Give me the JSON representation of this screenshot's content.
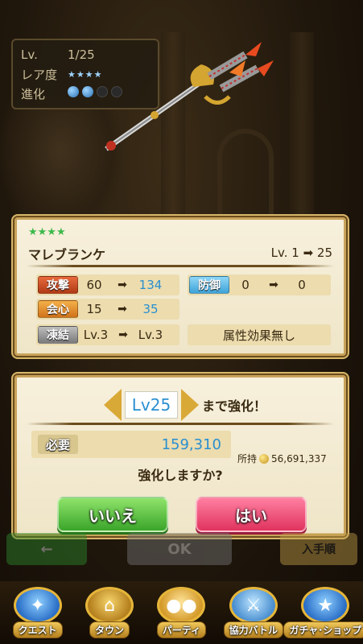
{
  "info": {
    "lv_label": "Lv.",
    "lv_value": "1/25",
    "rarity_label": "レア度",
    "rarity_stars": "★★★★",
    "evo_label": "進化",
    "evo_filled": 2,
    "evo_total": 4
  },
  "weapon": {
    "stars": "★★★★",
    "name": "マレブランケ",
    "level_text": "Lv. 1 ➡ 25",
    "stats": {
      "attack": {
        "label": "攻撃",
        "from": "60",
        "to": "134"
      },
      "defense": {
        "label": "防御",
        "from": "0",
        "to": "0"
      },
      "critical": {
        "label": "会心",
        "from": "15",
        "to": "35"
      },
      "freeze": {
        "label": "凍結",
        "from": "Lv.3",
        "to": "Lv.3"
      },
      "attribute_text": "属性効果無し"
    }
  },
  "enhance": {
    "target_lv": "Lv25",
    "until_text": "まで強化！",
    "need_label": "必要",
    "need_value": "159,310",
    "owned_label": "所持",
    "owned_value": "56,691,337",
    "question": "強化しますか?",
    "no_label": "いいえ",
    "yes_label": "はい"
  },
  "background_buttons": {
    "ok_label": "OK",
    "source_label": "入手順"
  },
  "nav": [
    {
      "label": "クエスト",
      "icon": "quest-icon"
    },
    {
      "label": "タウン",
      "icon": "town-icon"
    },
    {
      "label": "パーティ",
      "icon": "party-icon"
    },
    {
      "label": "協力バトル",
      "icon": "coop-battle-icon"
    },
    {
      "label": "ガチャ･ショップ",
      "icon": "gacha-shop-icon"
    }
  ]
}
